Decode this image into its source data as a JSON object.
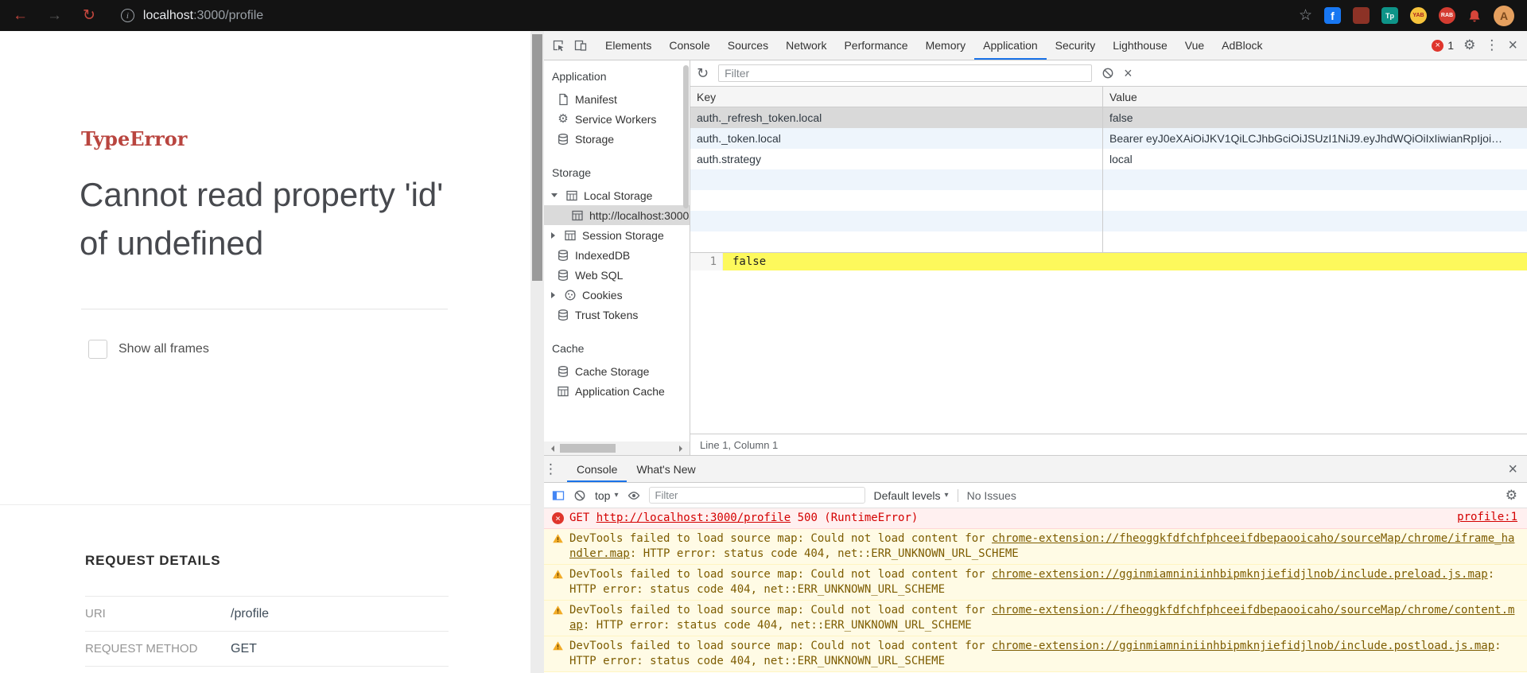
{
  "colors": {
    "accent_blue": "#1a73e8",
    "error_red": "#d40000",
    "warning_text": "#7d5c00",
    "error_heading_red": "#b9453f",
    "preview_highlight": "#fdf95c"
  },
  "browser": {
    "url": {
      "host": "localhost",
      "path": ":3000/profile"
    },
    "extensions": [
      {
        "label": "f"
      },
      {
        "label": ""
      },
      {
        "label": "Tp"
      },
      {
        "label": "YAB"
      },
      {
        "label": "RAB"
      }
    ],
    "avatar_letter": "A"
  },
  "page": {
    "error_type": "TypeError",
    "error_message": "Cannot read property 'id' of undefined",
    "show_all_frames_label": "Show all frames",
    "request_details": {
      "title": "REQUEST DETAILS",
      "rows": [
        {
          "label": "URI",
          "value": "/profile"
        },
        {
          "label": "REQUEST METHOD",
          "value": "GET"
        }
      ]
    }
  },
  "devtools": {
    "tabs": {
      "items": [
        "Elements",
        "Console",
        "Sources",
        "Network",
        "Performance",
        "Memory",
        "Application",
        "Security",
        "Lighthouse",
        "Vue",
        "AdBlock"
      ],
      "error_count": "1"
    },
    "sidebar": {
      "section_application": "Application",
      "app_items": [
        "Manifest",
        "Service Workers",
        "Storage"
      ],
      "section_storage": "Storage",
      "storage_items": {
        "local_storage": "Local Storage",
        "origin": "http://localhost:3000",
        "session_storage": "Session Storage",
        "indexeddb": "IndexedDB",
        "web_sql": "Web SQL",
        "cookies": "Cookies",
        "trust_tokens": "Trust Tokens"
      },
      "section_cache": "Cache",
      "cache_items": [
        "Cache Storage",
        "Application Cache"
      ]
    },
    "storage_panel": {
      "filter_placeholder": "Filter",
      "col_key": "Key",
      "col_value": "Value",
      "rows": [
        {
          "key": "auth._refresh_token.local",
          "value": "false"
        },
        {
          "key": "auth._token.local",
          "value": "Bearer eyJ0eXAiOiJKV1QiLCJhbGciOiJSUzI1NiJ9.eyJhdWQiOiIxIiwianRpIjoi…"
        },
        {
          "key": "auth.strategy",
          "value": "local"
        }
      ],
      "preview": {
        "line_number": "1",
        "value": "false"
      },
      "status": "Line 1, Column 1"
    },
    "drawer": {
      "tab_console": "Console",
      "tab_whats_new": "What's New",
      "toolbar": {
        "context": "top",
        "filter_placeholder": "Filter",
        "levels": "Default levels",
        "issues": "No Issues"
      },
      "messages": [
        {
          "pre": "GET ",
          "link": "http://localhost:3000/profile",
          "post": " 500 (RuntimeError)",
          "source": "profile:1"
        },
        {
          "pre": "DevTools failed to load source map: Could not load content for ",
          "link": "chrome-extension://fheoggkfdfchfphceeifdbepaooicaho/sourceMap/chrome/iframe_handler.map",
          "post": ": HTTP error: status code 404, net::ERR_UNKNOWN_URL_SCHEME"
        },
        {
          "pre": "DevTools failed to load source map: Could not load content for ",
          "link": "chrome-extension://gginmiamniniinhbipmknjiefidjlnob/include.preload.js.map",
          "post": ": HTTP error: status code 404, net::ERR_UNKNOWN_URL_SCHEME"
        },
        {
          "pre": "DevTools failed to load source map: Could not load content for ",
          "link": "chrome-extension://fheoggkfdfchfphceeifdbepaooicaho/sourceMap/chrome/content.map",
          "post": ": HTTP error: status code 404, net::ERR_UNKNOWN_URL_SCHEME"
        },
        {
          "pre": "DevTools failed to load source map: Could not load content for ",
          "link": "chrome-extension://gginmiamniniinhbipmknjiefidjlnob/include.postload.js.map",
          "post": ": HTTP error: status code 404, net::ERR_UNKNOWN_URL_SCHEME"
        }
      ]
    }
  }
}
